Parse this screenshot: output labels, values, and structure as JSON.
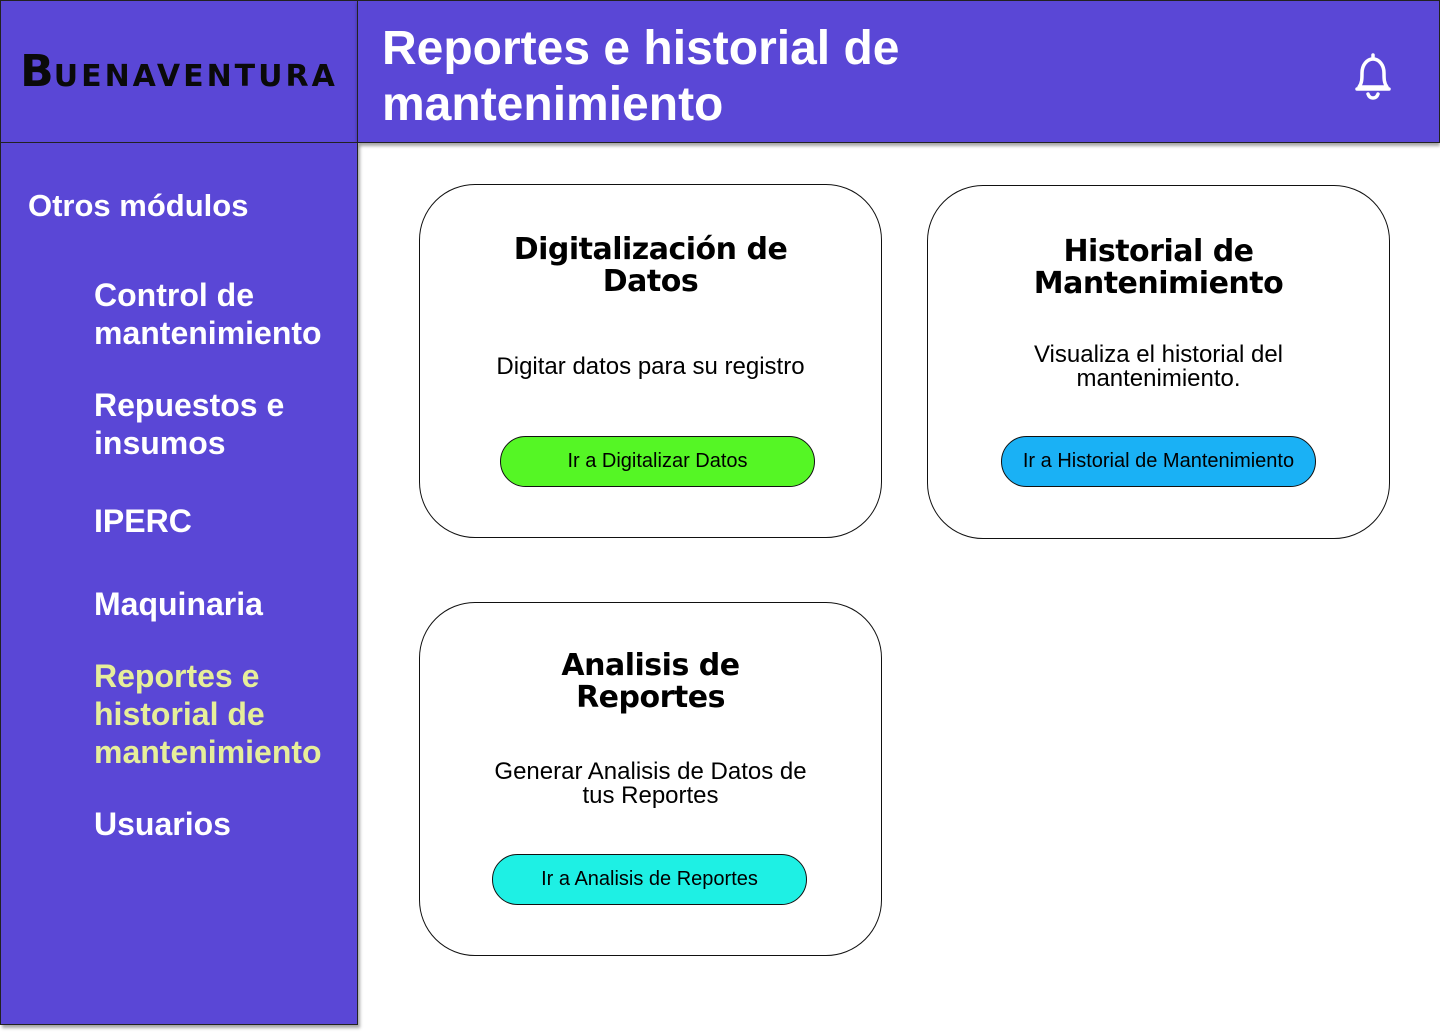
{
  "brand": {
    "logo_initial": "B",
    "logo_rest": "UENAVENTURA"
  },
  "header": {
    "title": "Reportes e historial de mantenimiento"
  },
  "icons": {
    "notifications": "bell-icon"
  },
  "colors": {
    "primary": "#5a47d6",
    "active_nav": "#e6ee9a",
    "digitalizar_button": "#55f625",
    "historial_button": "#1ab1f5",
    "analisis_button": "#1ef0e4"
  },
  "sidebar": {
    "heading": "Otros módulos",
    "items": [
      {
        "label": "Control de mantenimiento",
        "active": false
      },
      {
        "label": "Repuestos e insumos",
        "active": false
      },
      {
        "label": "IPERC",
        "active": false
      },
      {
        "label": "Maquinaria",
        "active": false
      },
      {
        "label": "Reportes e historial de mantenimiento",
        "active": true
      },
      {
        "label": "Usuarios",
        "active": false
      }
    ]
  },
  "cards": [
    {
      "title": "Digitalización de Datos",
      "description": "Digitar datos para su registro",
      "button_label": "Ir a Digitalizar Datos"
    },
    {
      "title": "Historial de Mantenimiento",
      "description": "Visualiza el historial del mantenimiento.",
      "button_label": "Ir a Historial de Mantenimiento"
    },
    {
      "title": "Analisis de Reportes",
      "description": "Generar Analisis de Datos de tus Reportes",
      "button_label": "Ir a Analisis de Reportes"
    }
  ]
}
